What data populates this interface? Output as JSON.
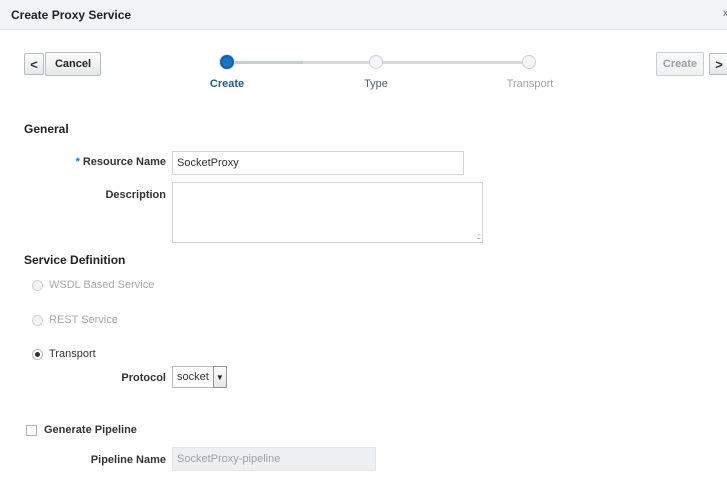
{
  "dialog": {
    "title": "Create Proxy Service",
    "close_glyph": "x"
  },
  "nav": {
    "prev_glyph": "<",
    "cancel_label": "Cancel",
    "create_label": "Create",
    "next_glyph": ">"
  },
  "train": {
    "steps": [
      {
        "label": "Create",
        "state": "active"
      },
      {
        "label": "Type",
        "state": "idle"
      },
      {
        "label": "Transport",
        "state": "idle"
      }
    ]
  },
  "general": {
    "heading": "General",
    "resource_name": {
      "required_mark": "*",
      "label": "Resource Name",
      "value": "SocketProxy"
    },
    "description": {
      "label": "Description",
      "value": ""
    }
  },
  "service_definition": {
    "heading": "Service Definition",
    "options": [
      {
        "label": "WSDL Based Service",
        "checked": false,
        "disabled": true
      },
      {
        "label": "REST Service",
        "checked": false,
        "disabled": true
      },
      {
        "label": "Transport",
        "checked": true,
        "disabled": false
      }
    ],
    "protocol": {
      "label": "Protocol",
      "value": "socket"
    }
  },
  "pipeline": {
    "generate_label": "Generate Pipeline",
    "generate_checked": false,
    "name_label": "Pipeline Name",
    "name_value": "SocketProxy-pipeline"
  }
}
